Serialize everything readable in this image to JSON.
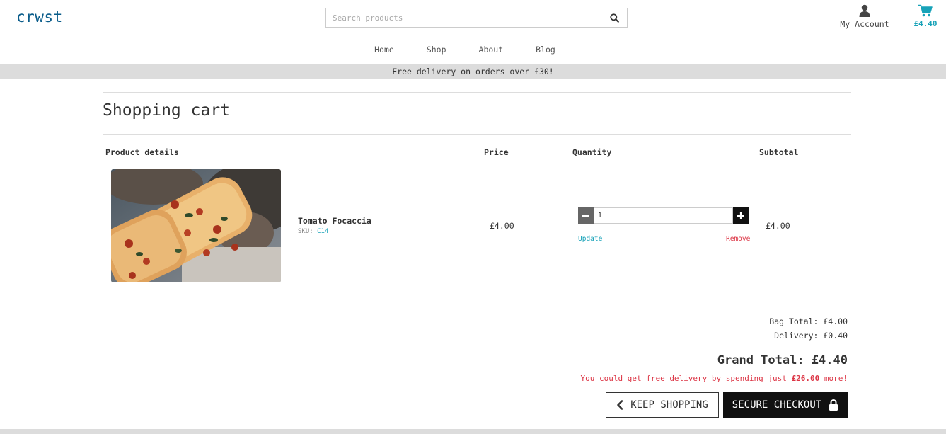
{
  "brand": {
    "logo": "crwst"
  },
  "search": {
    "placeholder": "Search products",
    "icon": "search-icon"
  },
  "account": {
    "label": "My Account",
    "icon": "user-icon"
  },
  "cart": {
    "total": "£4.40",
    "icon": "shopping-cart-icon"
  },
  "nav": {
    "items": [
      "Home",
      "Shop",
      "About",
      "Blog"
    ]
  },
  "banner": {
    "text": "Free delivery on orders over £30!"
  },
  "page": {
    "title": "Shopping cart"
  },
  "table": {
    "headers": {
      "product": "Product details",
      "price": "Price",
      "quantity": "Quantity",
      "subtotal": "Subtotal"
    },
    "rows": [
      {
        "name": "Tomato Focaccia",
        "sku_label": "SKU:",
        "sku": "C14",
        "price": "£4.00",
        "quantity": "1",
        "update": "Update",
        "remove": "Remove",
        "subtotal": "£4.00"
      }
    ]
  },
  "summary": {
    "bag_total": "Bag Total: £4.00",
    "delivery": "Delivery: £0.40",
    "grand_total": "Grand Total: £4.40",
    "free_delivery_prefix": "You could get free delivery by spending just ",
    "free_delivery_amount": "£26.00",
    "free_delivery_suffix": " more!"
  },
  "buttons": {
    "keep_shopping": "KEEP SHOPPING",
    "secure_checkout": "SECURE CHECKOUT"
  },
  "colors": {
    "brand": "#0a5c8a",
    "accent": "#17a2b8",
    "danger": "#dc3545",
    "dark": "#111111"
  }
}
